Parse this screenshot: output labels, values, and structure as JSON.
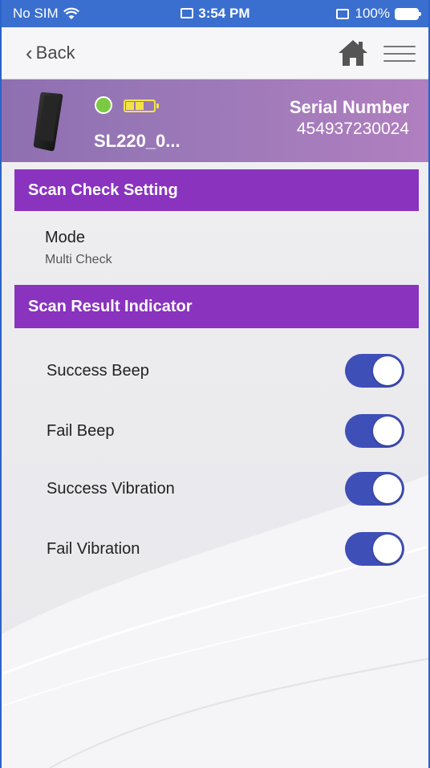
{
  "status_bar": {
    "carrier": "No SIM",
    "time": "3:54 PM",
    "battery_percent": "100%"
  },
  "nav": {
    "back_label": "Back",
    "icons": [
      "home-icon",
      "menu-icon"
    ]
  },
  "device": {
    "name": "SL220_0...",
    "serial_label": "Serial Number",
    "serial_value": "454937230024",
    "connection_color": "#7ac943",
    "battery_level": 0.66
  },
  "sections": {
    "scan_check": {
      "title": "Scan Check Setting",
      "mode_label": "Mode",
      "mode_value": "Multi Check"
    },
    "scan_result": {
      "title": "Scan Result Indicator",
      "items": [
        {
          "label": "Success Beep",
          "on": true
        },
        {
          "label": "Fail Beep",
          "on": true
        },
        {
          "label": "Success Vibration",
          "on": true
        },
        {
          "label": "Fail Vibration",
          "on": true
        }
      ]
    }
  },
  "colors": {
    "section_header": "#8a33bf",
    "toggle_on": "#3f4fb8",
    "status_bar": "#3a6fd0"
  }
}
